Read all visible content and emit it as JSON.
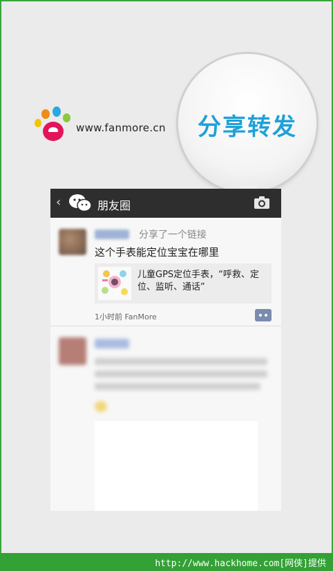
{
  "brand": {
    "url_text": "www.fanmore.cn",
    "colors": {
      "frame": "#3aa63a",
      "bubble_text": "#1fa1d8",
      "bottom_bar": "#33a135"
    }
  },
  "bubble": {
    "text": "分享转发"
  },
  "wechat": {
    "topbar": {
      "back_icon": "chevron-left-icon",
      "app_icon": "wechat-icon",
      "title": "朋友圈",
      "camera_icon": "camera-icon"
    },
    "post": {
      "shared_label": "分享了一个链接",
      "text": "这个手表能定位宝宝在哪里",
      "link_title": "儿童GPS定位手表，“呼救、定位、监听、通话”",
      "time_source": "1小时前  FanMore",
      "comment_icon": "comment-icon"
    }
  },
  "footer": {
    "text": "http://www.hackhome.com[网侠]提供"
  }
}
